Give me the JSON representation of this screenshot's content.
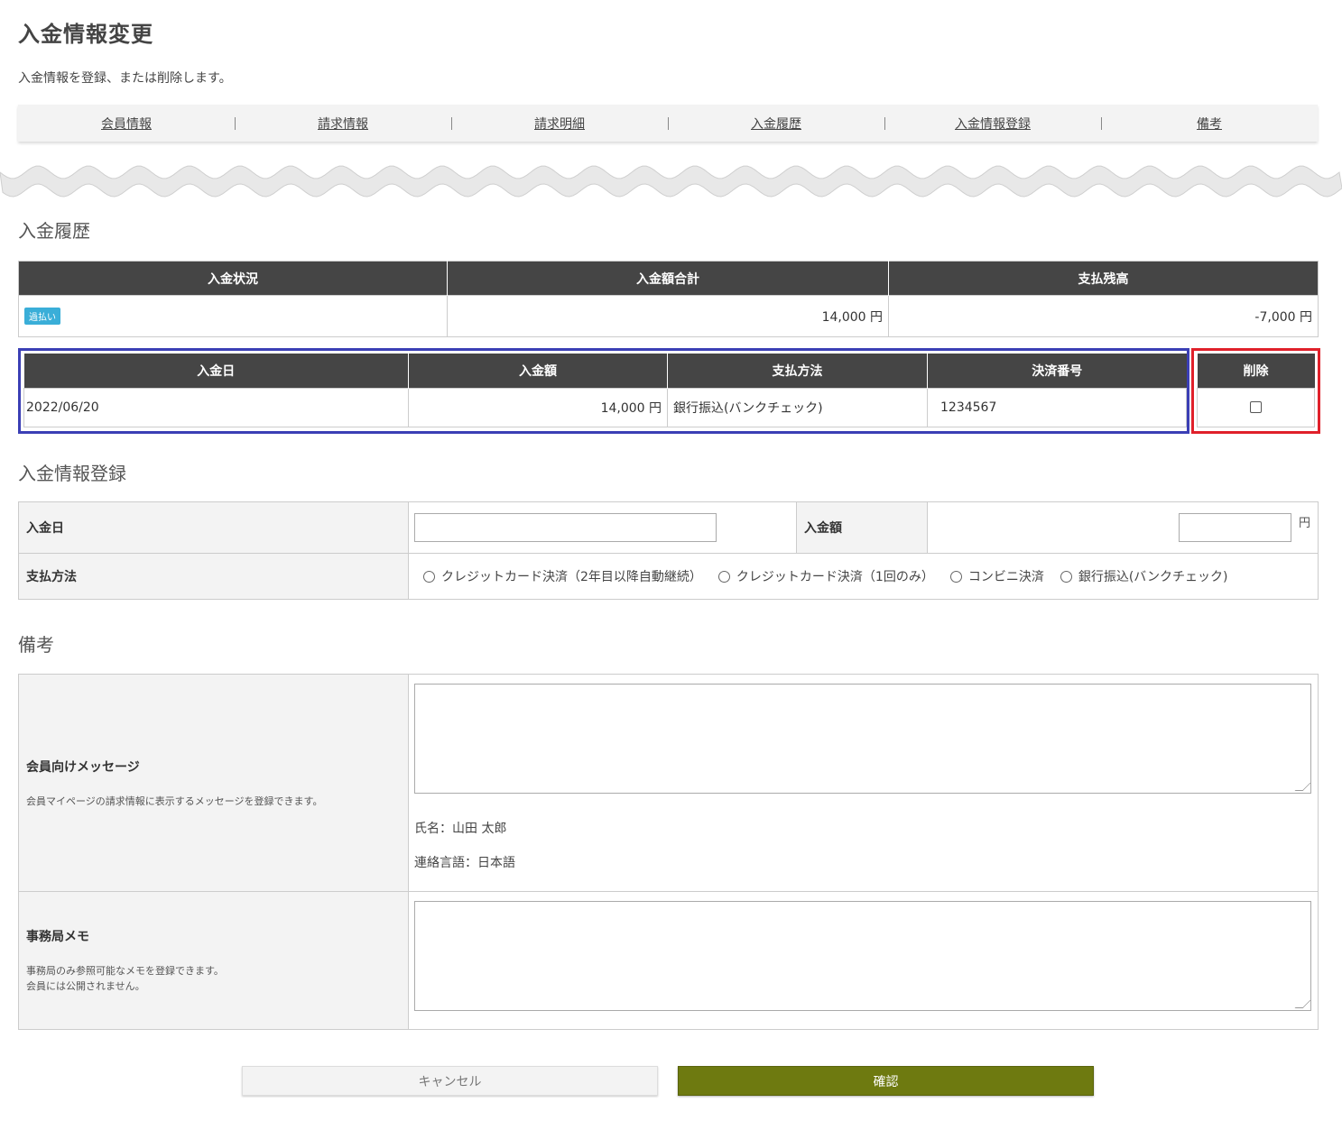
{
  "page": {
    "title": "入金情報変更",
    "description": "入金情報を登録、または削除します。"
  },
  "nav": {
    "items": [
      "会員情報",
      "請求情報",
      "請求明細",
      "入金履歴",
      "入金情報登録",
      "備考"
    ]
  },
  "payment_history": {
    "section_title": "入金履歴",
    "summary": {
      "headers": [
        "入金状況",
        "入金額合計",
        "支払残高"
      ],
      "status_badge": "過払い",
      "total": "14,000 円",
      "balance": "-7,000 円"
    },
    "records": {
      "headers": [
        "入金日",
        "入金額",
        "支払方法",
        "決済番号"
      ],
      "rows": [
        {
          "date": "2022/06/20",
          "amount": "14,000 円",
          "method": "銀行振込(バンクチェック)",
          "settlement_no": "1234567"
        }
      ]
    },
    "delete_header": "削除"
  },
  "registration": {
    "section_title": "入金情報登録",
    "date_label": "入金日",
    "date_value": "",
    "amount_label": "入金額",
    "amount_value": "",
    "yen_unit": "円",
    "method_label": "支払方法",
    "methods": [
      "クレジットカード決済（2年目以降自動継続）",
      "クレジットカード決済（1回のみ）",
      "コンビニ決済",
      "銀行振込(バンクチェック)"
    ]
  },
  "notes": {
    "section_title": "備考",
    "member_message": {
      "label": "会員向けメッセージ",
      "help": "会員マイページの請求情報に表示するメッセージを登録できます。",
      "value": "",
      "name_line": "氏名：山田 太郎",
      "language_line": "連絡言語：日本語"
    },
    "office_memo": {
      "label": "事務局メモ",
      "help_line1": "事務局のみ参照可能なメモを登録できます。",
      "help_line2": "会員には公開されません。",
      "value": ""
    }
  },
  "buttons": {
    "cancel": "キャンセル",
    "confirm": "確認"
  },
  "colors": {
    "header_dark": "#454545",
    "badge": "#3aaed8",
    "confirm_button": "#6e7a10",
    "highlight_blue": "#3b3fb5",
    "highlight_red": "#e0202a"
  }
}
